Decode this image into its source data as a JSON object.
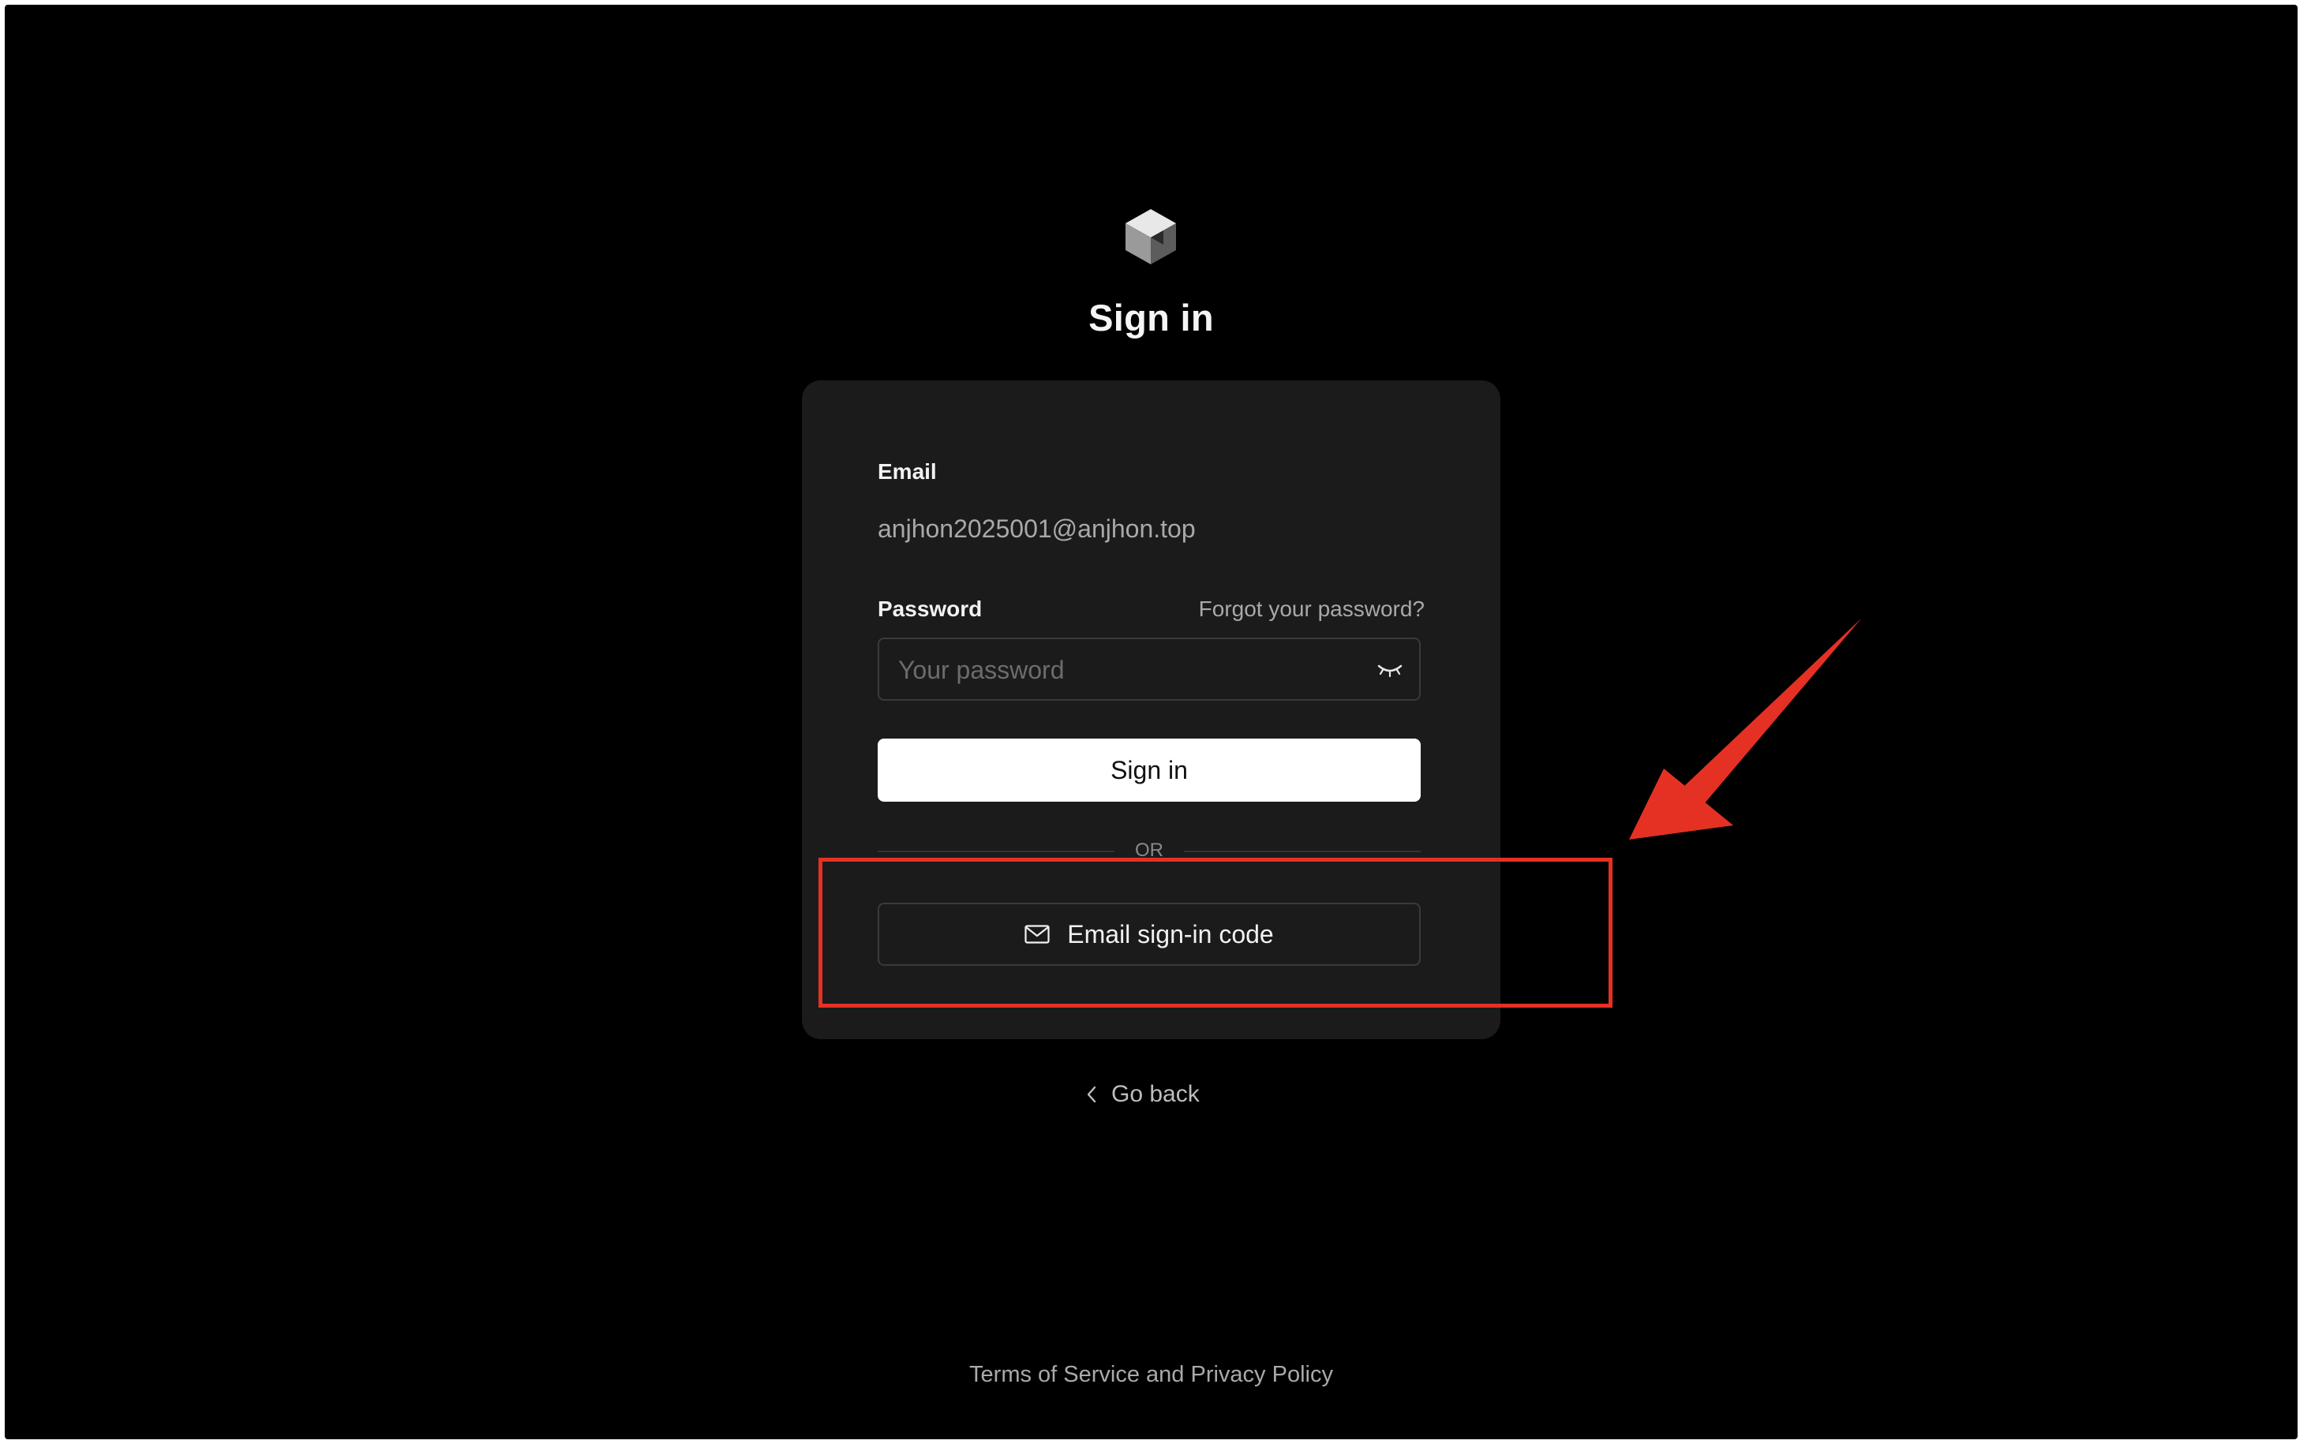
{
  "header": {
    "logo_icon": "cube-logo-icon",
    "title": "Sign in"
  },
  "form": {
    "email_label": "Email",
    "email_value": "anjhon2025001@anjhon.top",
    "password_label": "Password",
    "forgot_password": "Forgot your password?",
    "password_placeholder": "Your password",
    "password_value": "",
    "toggle_icon": "eye-closed-icon",
    "signin_button": "Sign in",
    "divider_text": "OR",
    "email_code_button": "Email sign-in code",
    "email_code_icon": "mail-icon"
  },
  "nav": {
    "go_back": "Go back",
    "go_back_icon": "chevron-left-icon"
  },
  "footer": {
    "terms": "Terms of Service and Privacy Policy"
  },
  "annotation": {
    "highlight_color": "#e53124",
    "arrow_color": "#e53124"
  },
  "colors": {
    "background": "#000000",
    "card": "#1b1b1b",
    "primary_button": "#ffffff"
  }
}
